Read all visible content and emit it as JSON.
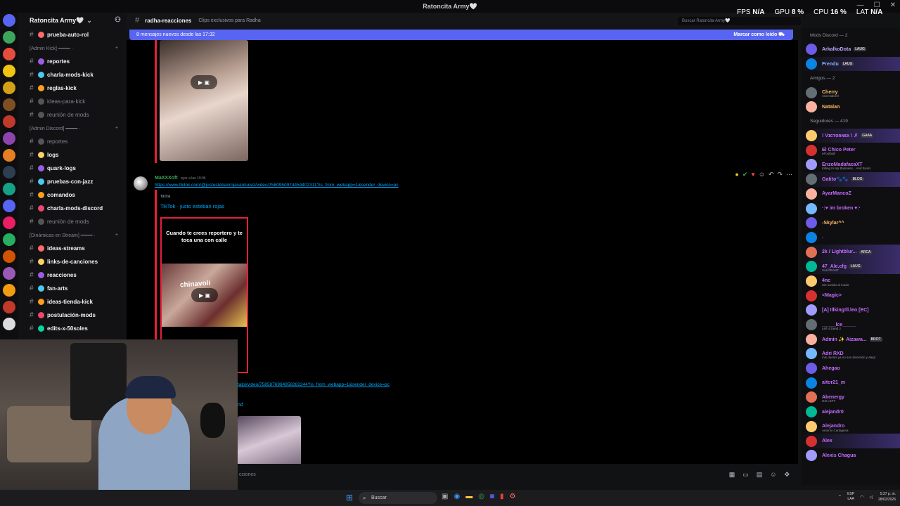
{
  "window": {
    "title": "Ratoncita Army🤍"
  },
  "overlay": {
    "fps_label": "FPS",
    "fps_value": "N/A",
    "gpu_label": "GPU",
    "gpu_value": "8 %",
    "cpu_label": "CPU",
    "cpu_value": "16 %",
    "lat_label": "LAT",
    "lat_value": "N/A"
  },
  "server": {
    "name": "Ratoncita Army🤍"
  },
  "channels": {
    "items": [
      {
        "type": "channel",
        "label": "prueba-auto-rol",
        "muted": false
      },
      {
        "type": "category",
        "label": "[Admin Kick] ━━━━ ·"
      },
      {
        "type": "channel",
        "label": "reportes",
        "muted": false
      },
      {
        "type": "channel",
        "label": "charla-mods-kick",
        "muted": false
      },
      {
        "type": "channel",
        "label": "reglas-kick",
        "muted": false
      },
      {
        "type": "channel",
        "label": "ideas-para-kick",
        "muted": true
      },
      {
        "type": "channel",
        "label": "reunión de mods",
        "muted": true
      },
      {
        "type": "category",
        "label": "[Admin Discord] ━━━━ ·"
      },
      {
        "type": "channel",
        "label": "reportes",
        "muted": true
      },
      {
        "type": "channel",
        "label": "logs",
        "muted": false
      },
      {
        "type": "channel",
        "label": "quark-logs",
        "muted": false
      },
      {
        "type": "channel",
        "label": "pruebas-con-jazz",
        "muted": false
      },
      {
        "type": "channel",
        "label": "comandos",
        "muted": false
      },
      {
        "type": "channel",
        "label": "charla-mods-discord",
        "muted": false
      },
      {
        "type": "channel",
        "label": "reunión de mods",
        "muted": true
      },
      {
        "type": "category",
        "label": "[Dinámicas en Stream] ━━━━ ·"
      },
      {
        "type": "channel",
        "label": "ideas-streams",
        "muted": false
      },
      {
        "type": "channel",
        "label": "links-de-canciones",
        "muted": false
      },
      {
        "type": "channel",
        "label": "reacciones",
        "muted": false
      },
      {
        "type": "channel",
        "label": "fan-arts",
        "muted": false
      },
      {
        "type": "channel",
        "label": "ideas-tienda-kick",
        "muted": false
      },
      {
        "type": "channel",
        "label": "postulación-mods",
        "muted": false
      },
      {
        "type": "channel",
        "label": "edits-x-50soles",
        "muted": false
      }
    ]
  },
  "chat": {
    "channel_name": "radha-reacciones",
    "topic": "Clips exclusivos para Radha",
    "search_placeholder": "Buscar Ratoncita Army🤍",
    "new_banner": "8 mensajes nuevos desde las 17:32",
    "mark_read": "Marcar como leído",
    "message": {
      "author": "MaXXXoft",
      "time": "ayer a las 19:06",
      "link": "https://www.tiktok.com/@justestebanrojasantunez/video/7580950974454402311?is_from_webapp=1&sender_device=pc",
      "embed_provider": "TikTok",
      "embed_title": "TikTok · justo esteban rojas",
      "caption": "Cuando te crees reportero y te toca una con calle",
      "frame_text": "chinavoli"
    },
    "second_link": "talpi/video/7585876984958282244?is_from_webapp=1&sender_device=pc",
    "second_tail": "nd",
    "composer_placeholder": "cciones"
  },
  "members": {
    "groups": [
      {
        "title": "Mods Discord — 2",
        "members": [
          {
            "name": "ArkalkoDota",
            "tag": "LAUG",
            "color": "#b9a6ff",
            "sub": ""
          },
          {
            "name": "Frendu",
            "tag": "LAUG",
            "color": "#8ab4ff",
            "sub": "",
            "highlight": true
          }
        ]
      },
      {
        "title": "Amigos — 2",
        "members": [
          {
            "name": "Cherry",
            "tag": "",
            "color": "#ffb86b",
            "sub": "Ana Gabriel"
          },
          {
            "name": "Natalan",
            "tag": "",
            "color": "#ffb86b",
            "sub": ""
          }
        ]
      },
      {
        "title": "Seguidores — 419",
        "members": [
          {
            "name": "! Vɪᴄᴛᴏʀɴᴇx ! ✗",
            "tag": "GAAA",
            "color": "#c56bff",
            "sub": "",
            "highlight": true
          },
          {
            "name": "El Chico Peter",
            "tag": "",
            "color": "#c56bff",
            "sub": "eFootball"
          },
          {
            "name": "EnzoMadafacaXT",
            "tag": "",
            "color": "#c56bff",
            "sub": "Killing In My Business... And Busin"
          },
          {
            "name": "Gatito🐾🐾",
            "tag": "BLOG",
            "color": "#c56bff",
            "sub": "",
            "highlight": true
          },
          {
            "name": "AyarMancoZ",
            "tag": "",
            "color": "#c56bff",
            "sub": ""
          },
          {
            "name": "·:♥ im broken ♥:·",
            "tag": "",
            "color": "#c56bff",
            "sub": ""
          },
          {
            "name": "-Skylar^^",
            "tag": "",
            "color": "#ffb86b",
            "sub": ""
          },
          {
            "name": ".",
            "tag": "",
            "color": "#c56bff",
            "sub": ""
          },
          {
            "name": "2k / Lightblur...",
            "tag": "ARCA",
            "color": "#c56bff",
            "sub": "",
            "highlight": true
          },
          {
            "name": "47_Ale.cfg",
            "tag": "LAUG",
            "color": "#c56bff",
            "sub": "VALORANT",
            "highlight": true
          },
          {
            "name": "4nc",
            "tag": "",
            "color": "#c56bff",
            "sub": "Sin sonido al modo"
          },
          {
            "name": "<Magic>",
            "tag": "",
            "color": "#c56bff",
            "sub": ""
          },
          {
            "name": "[A] Illking!ll.leo [EC]",
            "tag": "",
            "color": "#c56bff",
            "sub": ""
          },
          {
            "name": "_____lce_____",
            "tag": "",
            "color": "#c56bff",
            "sub": "Left 4 Dead 2"
          },
          {
            "name": "Admin ✨ Aizawa...",
            "tag": "BROT",
            "color": "#c56bff",
            "sub": ""
          },
          {
            "name": "Adri RXD",
            "tag": "",
            "color": "#c56bff",
            "sub": "mis duelos ya no son diversión y alegr"
          },
          {
            "name": "Ahegao",
            "tag": "",
            "color": "#c56bff",
            "sub": ""
          },
          {
            "name": "aitor21_m",
            "tag": "",
            "color": "#c56bff",
            "sub": ""
          },
          {
            "name": "Akenergy",
            "tag": "",
            "color": "#c56bff",
            "sub": "GO LEFT"
          },
          {
            "name": "alejandr0",
            "tag": "",
            "color": "#c56bff",
            "sub": ""
          },
          {
            "name": "Alejandro",
            "tag": "",
            "color": "#c56bff",
            "sub": "Antonio Cartagena"
          },
          {
            "name": "Alex",
            "tag": "",
            "color": "#c56bff",
            "sub": "",
            "highlight": true
          },
          {
            "name": "Alexis Chagua",
            "tag": "",
            "color": "#c56bff",
            "sub": ""
          }
        ]
      }
    ]
  },
  "taskbar": {
    "search_label": "Buscar",
    "lang1": "ESP",
    "lang2": "LAA",
    "time": "5:37 p. m.",
    "date": "28/02/2026"
  },
  "colors": {
    "accent": "#5865f2",
    "link": "#00a8fc",
    "embed_border": "#e91e3c",
    "online": "#3ba55d"
  }
}
